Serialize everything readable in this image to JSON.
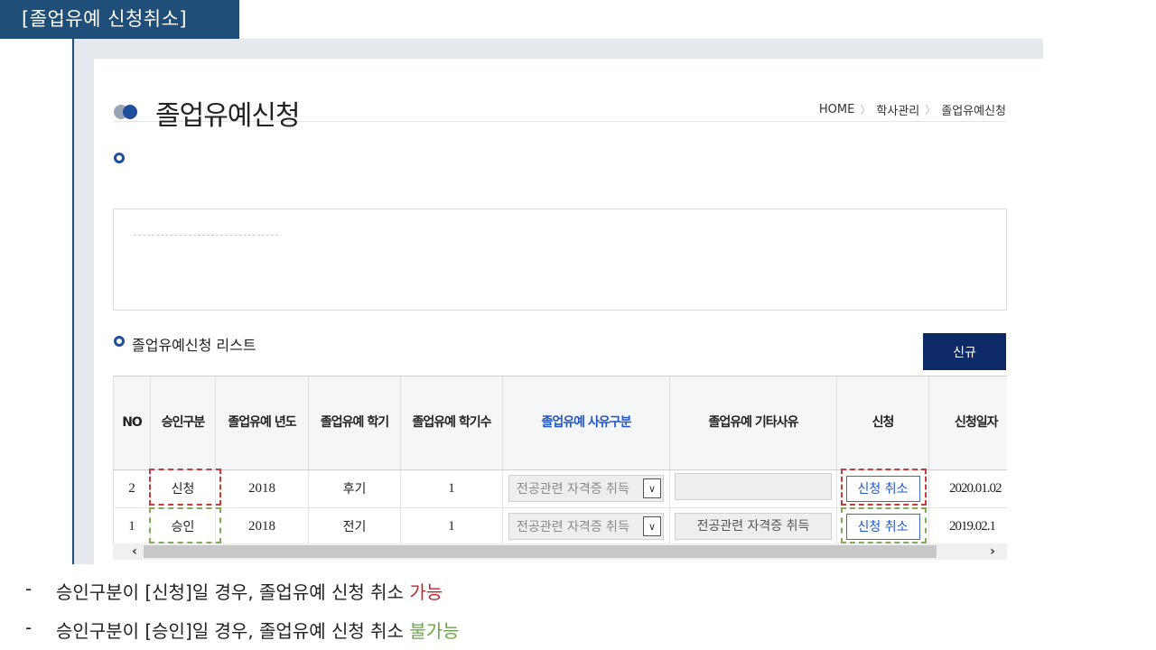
{
  "slide_tag": "[졸업유예 신청취소]",
  "page_title": "졸업유예신청",
  "breadcrumb": [
    "HOME",
    "학사관리",
    "졸업유예신청"
  ],
  "list_title": "졸업유예신청 리스트",
  "new_button": "신규",
  "table": {
    "headers": [
      "NO",
      "승인구분",
      "졸업유예 년도",
      "졸업유예 학기",
      "졸업유예 학기수",
      "졸업유예 사유구분",
      "졸업유예 기타사유",
      "신청",
      "신청일자"
    ],
    "rows": [
      {
        "no": "2",
        "status": "신청",
        "year": "2018",
        "term": "후기",
        "count": "1",
        "reason": "전공관련 자격증 취득",
        "etc": "",
        "action": "신청 취소",
        "date": "2020.01.02"
      },
      {
        "no": "1",
        "status": "승인",
        "year": "2018",
        "term": "전기",
        "count": "1",
        "reason": "전공관련 자격증 취득",
        "etc": "전공관련 자격증 취득",
        "action": "신청 취소",
        "date": "2019.02.1"
      }
    ]
  },
  "notes": [
    {
      "dash": "-",
      "text": "승인구분이 [신청]일 경우, 졸업유예 신청 취소",
      "highlight": "가능"
    },
    {
      "dash": "-",
      "text": "승인구분이 [승인]일 경우, 졸업유예 신청 취소",
      "highlight": "불가능"
    }
  ],
  "colors": {
    "brand": "#1f4e79",
    "button": "#0e2a66",
    "highlight_red": "#c63c3c",
    "highlight_green": "#7fae57"
  }
}
